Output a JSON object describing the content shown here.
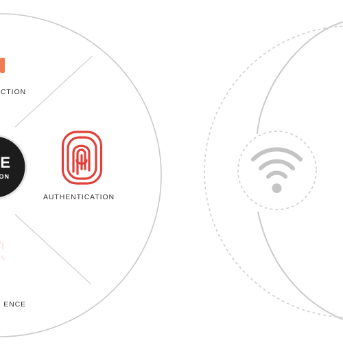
{
  "diagram": {
    "segments": {
      "top_label": "ECTION",
      "right_label": "AUTHENTICATION",
      "bottom_label": "ENCE"
    },
    "hub": {
      "line1": "E",
      "line2": "ON"
    },
    "icons": {
      "authentication": "fingerprint-icon",
      "top_segment": "orange-shape-icon",
      "bottom_segment": "faded-shape-icon",
      "connectivity": "wifi-icon"
    },
    "colors": {
      "accent_red": "#e0413b",
      "accent_orange": "#f07a52",
      "hub_fill": "#1a1a1a",
      "ring_stroke": "#c9c9c9",
      "wifi_gray": "#c4c4c4",
      "label_text": "#333333"
    }
  }
}
